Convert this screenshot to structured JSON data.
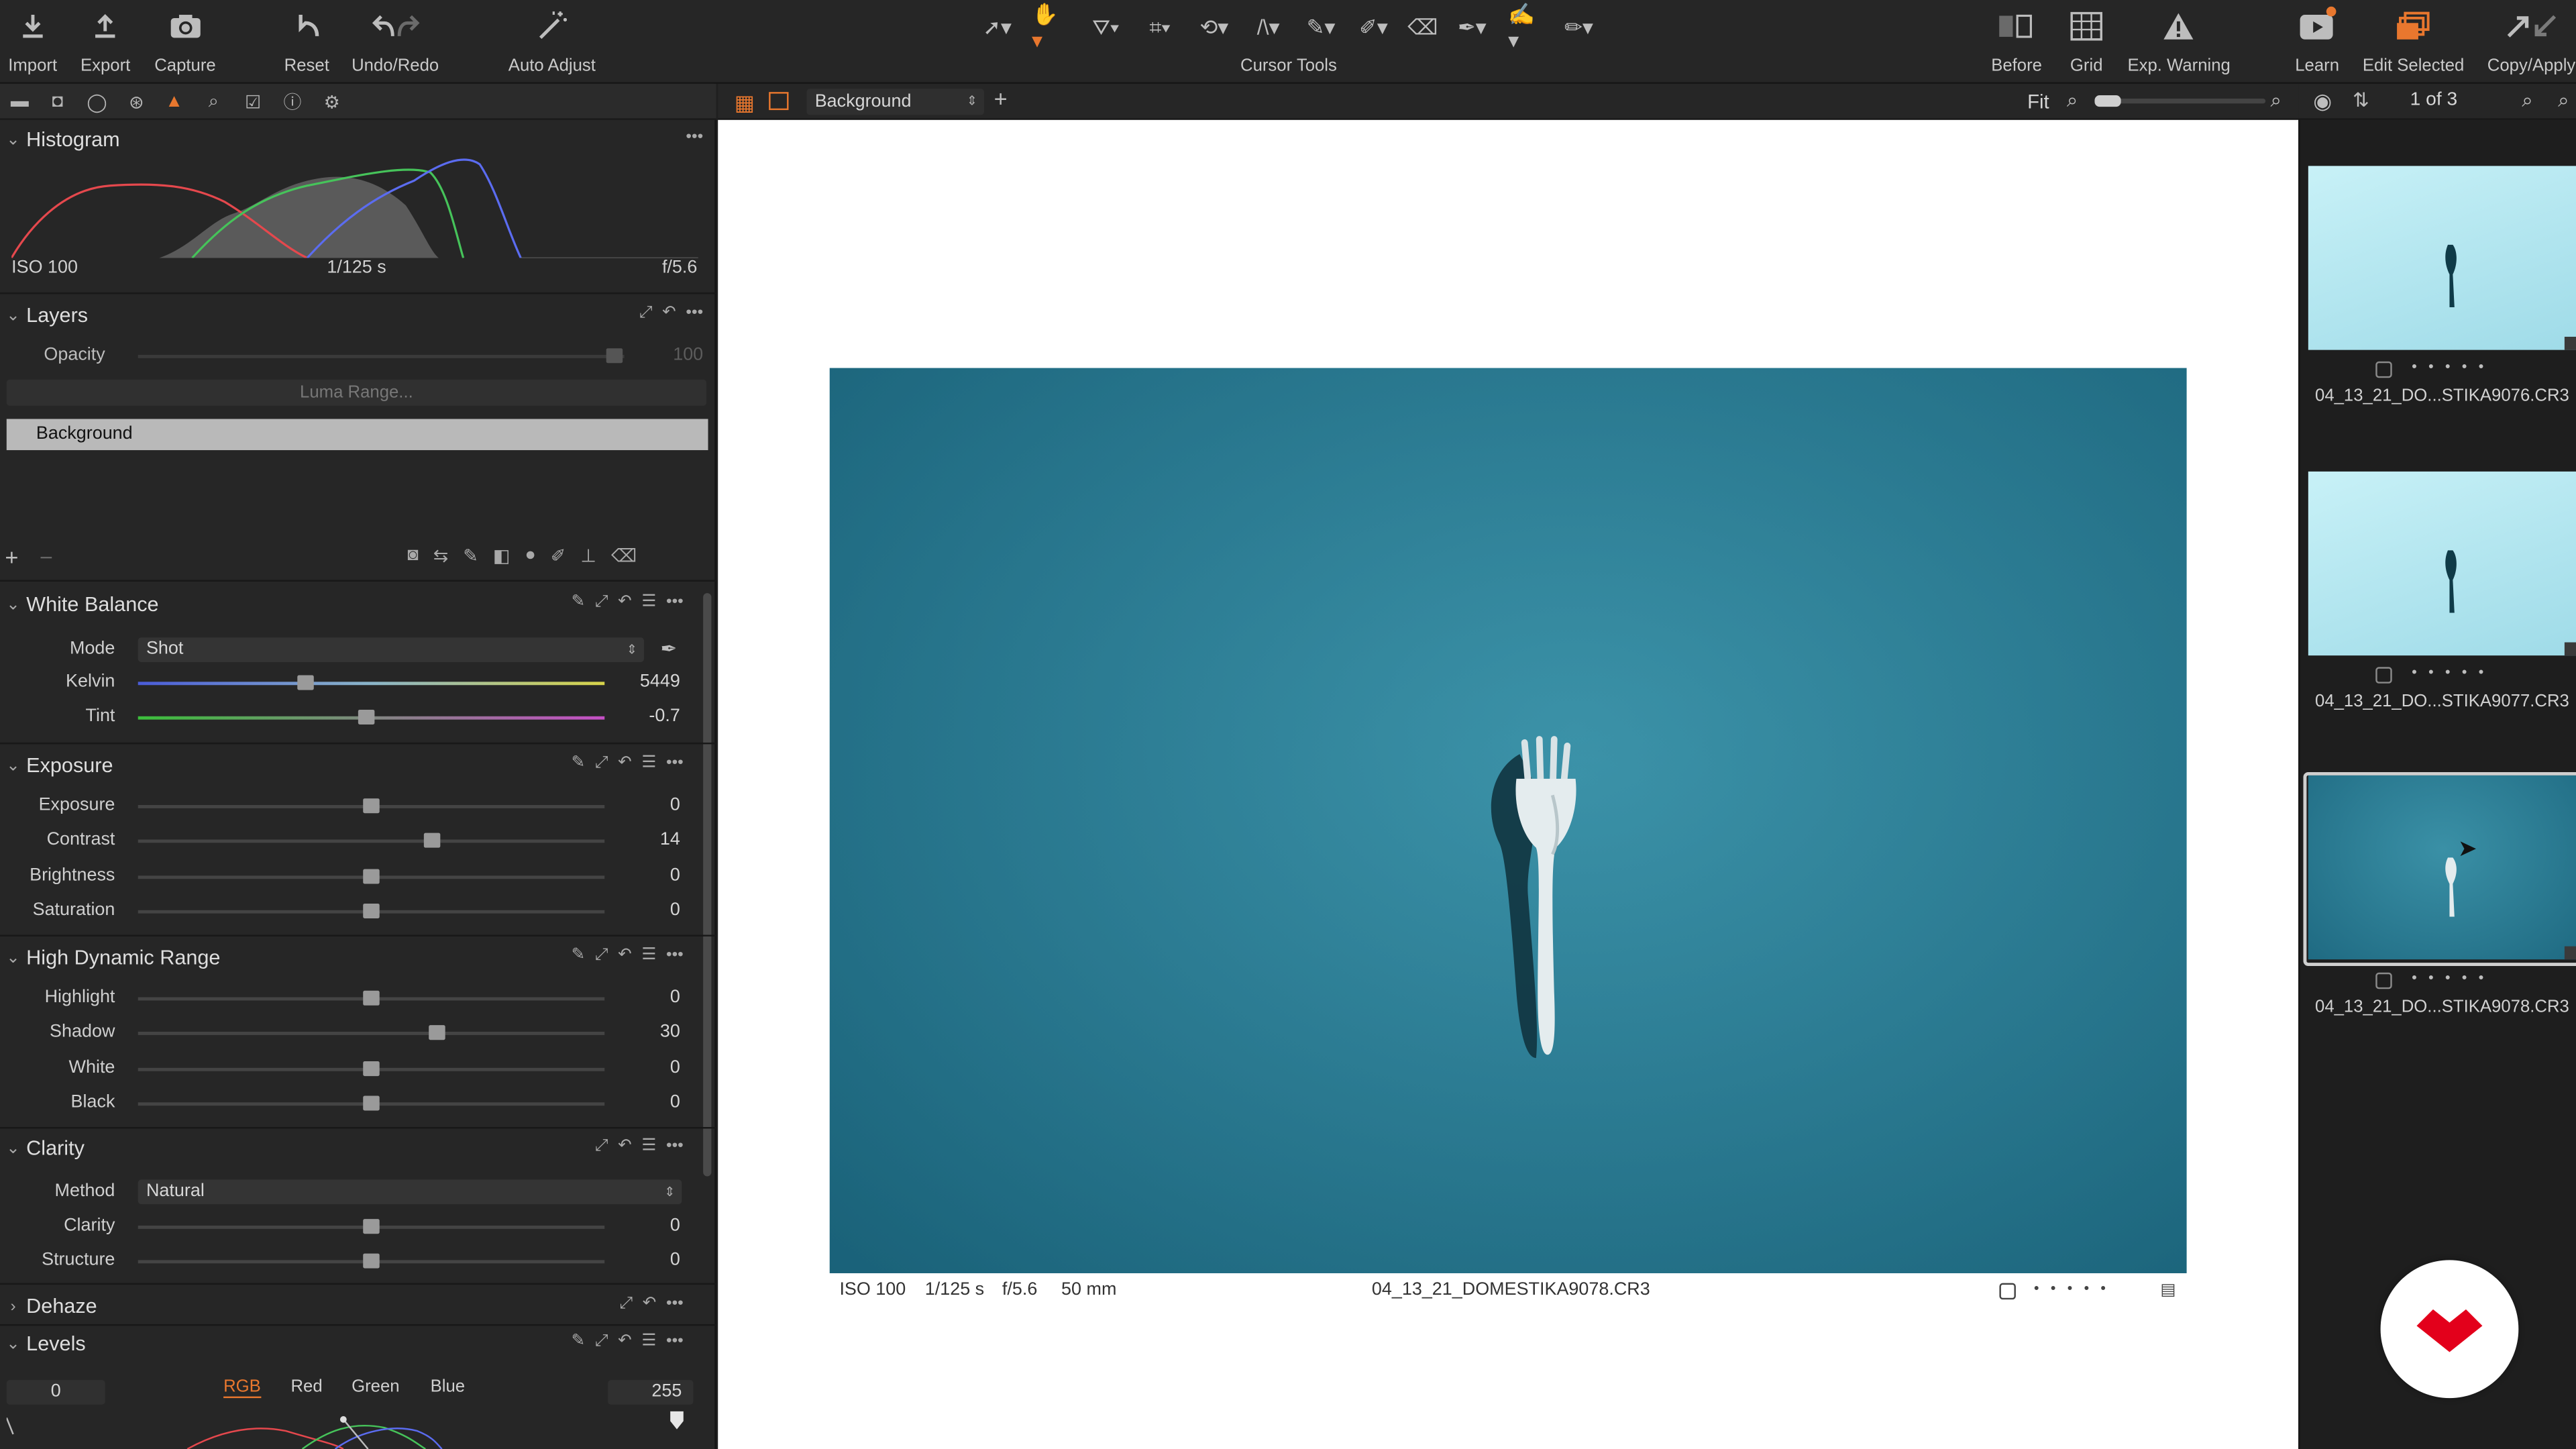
{
  "toolbar": {
    "import": "Import",
    "export": "Export",
    "capture": "Capture",
    "reset": "Reset",
    "undo_redo": "Undo/Redo",
    "auto_adjust": "Auto Adjust",
    "cursor_tools": "Cursor Tools",
    "before": "Before",
    "grid": "Grid",
    "exp_warning": "Exp. Warning",
    "learn": "Learn",
    "edit_selected": "Edit Selected",
    "copy_apply": "Copy/Apply"
  },
  "histogram": {
    "title": "Histogram",
    "iso": "ISO 100",
    "shutter": "1/125 s",
    "aperture": "f/5.6"
  },
  "layers": {
    "title": "Layers",
    "opacity_label": "Opacity",
    "opacity_value": "100",
    "luma_range": "Luma Range...",
    "background_layer": "Background"
  },
  "white_balance": {
    "title": "White Balance",
    "mode_label": "Mode",
    "mode_value": "Shot",
    "kelvin_label": "Kelvin",
    "kelvin_value": "5449",
    "kelvin_level": 0.36,
    "tint_label": "Tint",
    "tint_value": "-0.7",
    "tint_level": 0.49
  },
  "exposure": {
    "title": "Exposure",
    "rows": [
      {
        "label": "Exposure",
        "value": "0",
        "level": 0.5
      },
      {
        "label": "Contrast",
        "value": "14",
        "level": 0.63
      },
      {
        "label": "Brightness",
        "value": "0",
        "level": 0.5
      },
      {
        "label": "Saturation",
        "value": "0",
        "level": 0.5
      }
    ]
  },
  "hdr": {
    "title": "High Dynamic Range",
    "rows": [
      {
        "label": "Highlight",
        "value": "0",
        "level": 0.5
      },
      {
        "label": "Shadow",
        "value": "30",
        "level": 0.64
      },
      {
        "label": "White",
        "value": "0",
        "level": 0.5
      },
      {
        "label": "Black",
        "value": "0",
        "level": 0.5
      }
    ]
  },
  "clarity": {
    "title": "Clarity",
    "method_label": "Method",
    "method_value": "Natural",
    "rows": [
      {
        "label": "Clarity",
        "value": "0",
        "level": 0.5
      },
      {
        "label": "Structure",
        "value": "0",
        "level": 0.5
      }
    ]
  },
  "dehaze": {
    "title": "Dehaze"
  },
  "levels": {
    "title": "Levels",
    "low": "0",
    "high": "255",
    "channels": [
      "RGB",
      "Red",
      "Green",
      "Blue"
    ]
  },
  "viewer": {
    "layer_select": "Background",
    "fit": "Fit",
    "meta_iso": "ISO 100",
    "meta_shutter": "1/125 s",
    "meta_aperture": "f/5.6",
    "meta_focal": "50 mm",
    "filename": "04_13_21_DOMESTIKA9078.CR3"
  },
  "filmstrip": {
    "counter": "1 of 3",
    "items": [
      {
        "name": "04_13_21_DO...STIKA9076.CR3"
      },
      {
        "name": "04_13_21_DO...STIKA9077.CR3"
      },
      {
        "name": "04_13_21_DO...STIKA9078.CR3"
      }
    ]
  },
  "colors": {
    "accent": "#e8772e",
    "photo_bg": "#2d7e96",
    "brand_red": "#e3001b"
  }
}
